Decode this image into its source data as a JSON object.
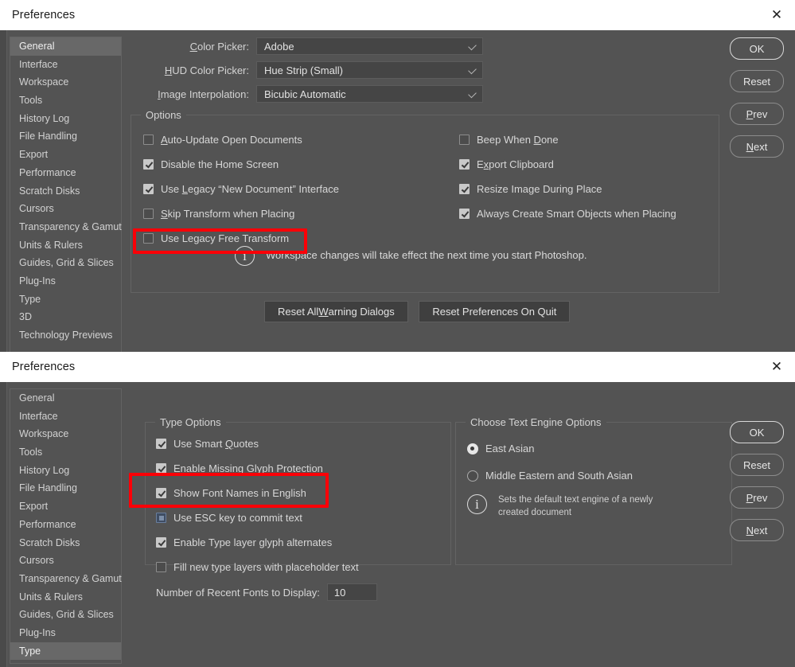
{
  "sidebar_items": [
    "General",
    "Interface",
    "Workspace",
    "Tools",
    "History Log",
    "File Handling",
    "Export",
    "Performance",
    "Scratch Disks",
    "Cursors",
    "Transparency & Gamut",
    "Units & Rulers",
    "Guides, Grid & Slices",
    "Plug-Ins",
    "Type",
    "3D",
    "Technology Previews"
  ],
  "dialog_general": {
    "title": "Preferences",
    "close_icon": "close-icon",
    "selected_sidebar": "General",
    "fields": [
      {
        "label_pre": "",
        "label_key": "C",
        "label_post": "olor Picker:",
        "value": "Adobe"
      },
      {
        "label_pre": "",
        "label_key": "H",
        "label_post": "UD Color Picker:",
        "value": "Hue Strip (Small)"
      },
      {
        "label_pre": "",
        "label_key": "I",
        "label_post": "mage Interpolation:",
        "value": "Bicubic Automatic"
      }
    ],
    "options_group_title": "Options",
    "options_left": [
      {
        "label_key": "A",
        "label_post": "uto-Update Open Documents",
        "checked": false
      },
      {
        "label_key": "",
        "label_post": "Disable the Home Screen",
        "checked": true
      },
      {
        "label_key": "",
        "label_post": "Use Legacy “New Document” Interface",
        "checked": true,
        "underline_at": "L"
      },
      {
        "label_key": "S",
        "label_post": "kip Transform when Placing",
        "checked": false
      },
      {
        "label_key": "",
        "label_post": "Use Legacy Free Transform",
        "checked": false,
        "highlighted": true
      }
    ],
    "options_right": [
      {
        "label_key": "",
        "label_post": "Beep When Done",
        "checked": false,
        "underline_at": "D"
      },
      {
        "label_key": "",
        "label_post": "Export Clipboard",
        "checked": true,
        "underline_at": "x"
      },
      {
        "label_key": "",
        "label_post": "Resize Image During Place",
        "checked": true,
        "underline_at": "g"
      },
      {
        "label_key": "",
        "label_post": "Always Create Smart Objects when Placing",
        "checked": true,
        "underline_at": "j"
      }
    ],
    "info_icon": "info-icon",
    "info_message": "Workspace changes will take effect the next time you start Photoshop.",
    "reset_warning_btn": "Reset All Warning Dialogs",
    "reset_prefs_btn": "Reset Preferences On Quit",
    "buttons": [
      {
        "label": "OK",
        "primary": true
      },
      {
        "label": "Reset",
        "primary": false
      },
      {
        "label": "Prev",
        "primary": false
      },
      {
        "label": "Next",
        "primary": false
      }
    ]
  },
  "dialog_type": {
    "title": "Preferences",
    "close_icon": "close-icon",
    "selected_sidebar": "Type",
    "type_options_title": "Type Options",
    "type_options": [
      {
        "label": "Use Smart Quotes",
        "checked": true
      },
      {
        "label": "Enable Missing Glyph Protection",
        "checked": true
      },
      {
        "label": "Show Font Names in English",
        "checked": true
      },
      {
        "label": "Use ESC key to commit text",
        "checked": false,
        "focused": true,
        "highlighted": true
      },
      {
        "label": "Enable Type layer glyph alternates",
        "checked": true
      },
      {
        "label": "Fill new type layers with placeholder text",
        "checked": false
      }
    ],
    "recent_fonts_label": "Number of Recent Fonts to Display:",
    "recent_fonts_value": "10",
    "engine_group_title": "Choose Text Engine Options",
    "engine_options": [
      {
        "label": "East Asian",
        "selected": true
      },
      {
        "label": "Middle Eastern and South Asian",
        "selected": false
      }
    ],
    "engine_info_icon": "info-icon",
    "engine_info_line1": "Sets the default text engine of a newly",
    "engine_info_line2": "created document",
    "buttons": [
      {
        "label": "OK",
        "primary": true
      },
      {
        "label": "Reset",
        "primary": false
      },
      {
        "label": "Prev",
        "primary": false
      },
      {
        "label": "Next",
        "primary": false
      }
    ]
  },
  "annotations": {
    "highlight_color": "#fb0007",
    "box1_target": "Use Legacy Free Transform",
    "box2_target": "Use ESC key to commit text"
  }
}
